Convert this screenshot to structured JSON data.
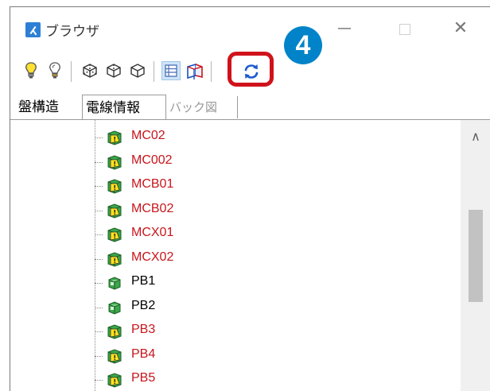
{
  "window": {
    "title": "ブラウザ"
  },
  "callout": {
    "number": "4"
  },
  "tabs": [
    "盤構造",
    "電線情報",
    "バック図"
  ],
  "tree": {
    "rows": [
      {
        "label": "MC02",
        "status": "warning"
      },
      {
        "label": "MC002",
        "status": "warning"
      },
      {
        "label": "MCB01",
        "status": "warning"
      },
      {
        "label": "MCB02",
        "status": "warning"
      },
      {
        "label": "MCX01",
        "status": "warning"
      },
      {
        "label": "MCX02",
        "status": "warning"
      },
      {
        "label": "PB1",
        "status": "ok"
      },
      {
        "label": "PB2",
        "status": "ok"
      },
      {
        "label": "PB3",
        "status": "warning"
      },
      {
        "label": "PB4",
        "status": "warning"
      },
      {
        "label": "PB5",
        "status": "warning"
      }
    ]
  },
  "colors": {
    "warning_text": "#c8151b",
    "ok_text": "#000000",
    "highlight": "#d0121b",
    "callout": "#0083c9"
  },
  "icons": [
    "bulb-on-icon",
    "bulb-off-icon",
    "cube-wireframe-icon",
    "cube-solid-icon",
    "cube-outline-icon",
    "list-view-icon",
    "box-view-icon",
    "refresh-icon"
  ]
}
